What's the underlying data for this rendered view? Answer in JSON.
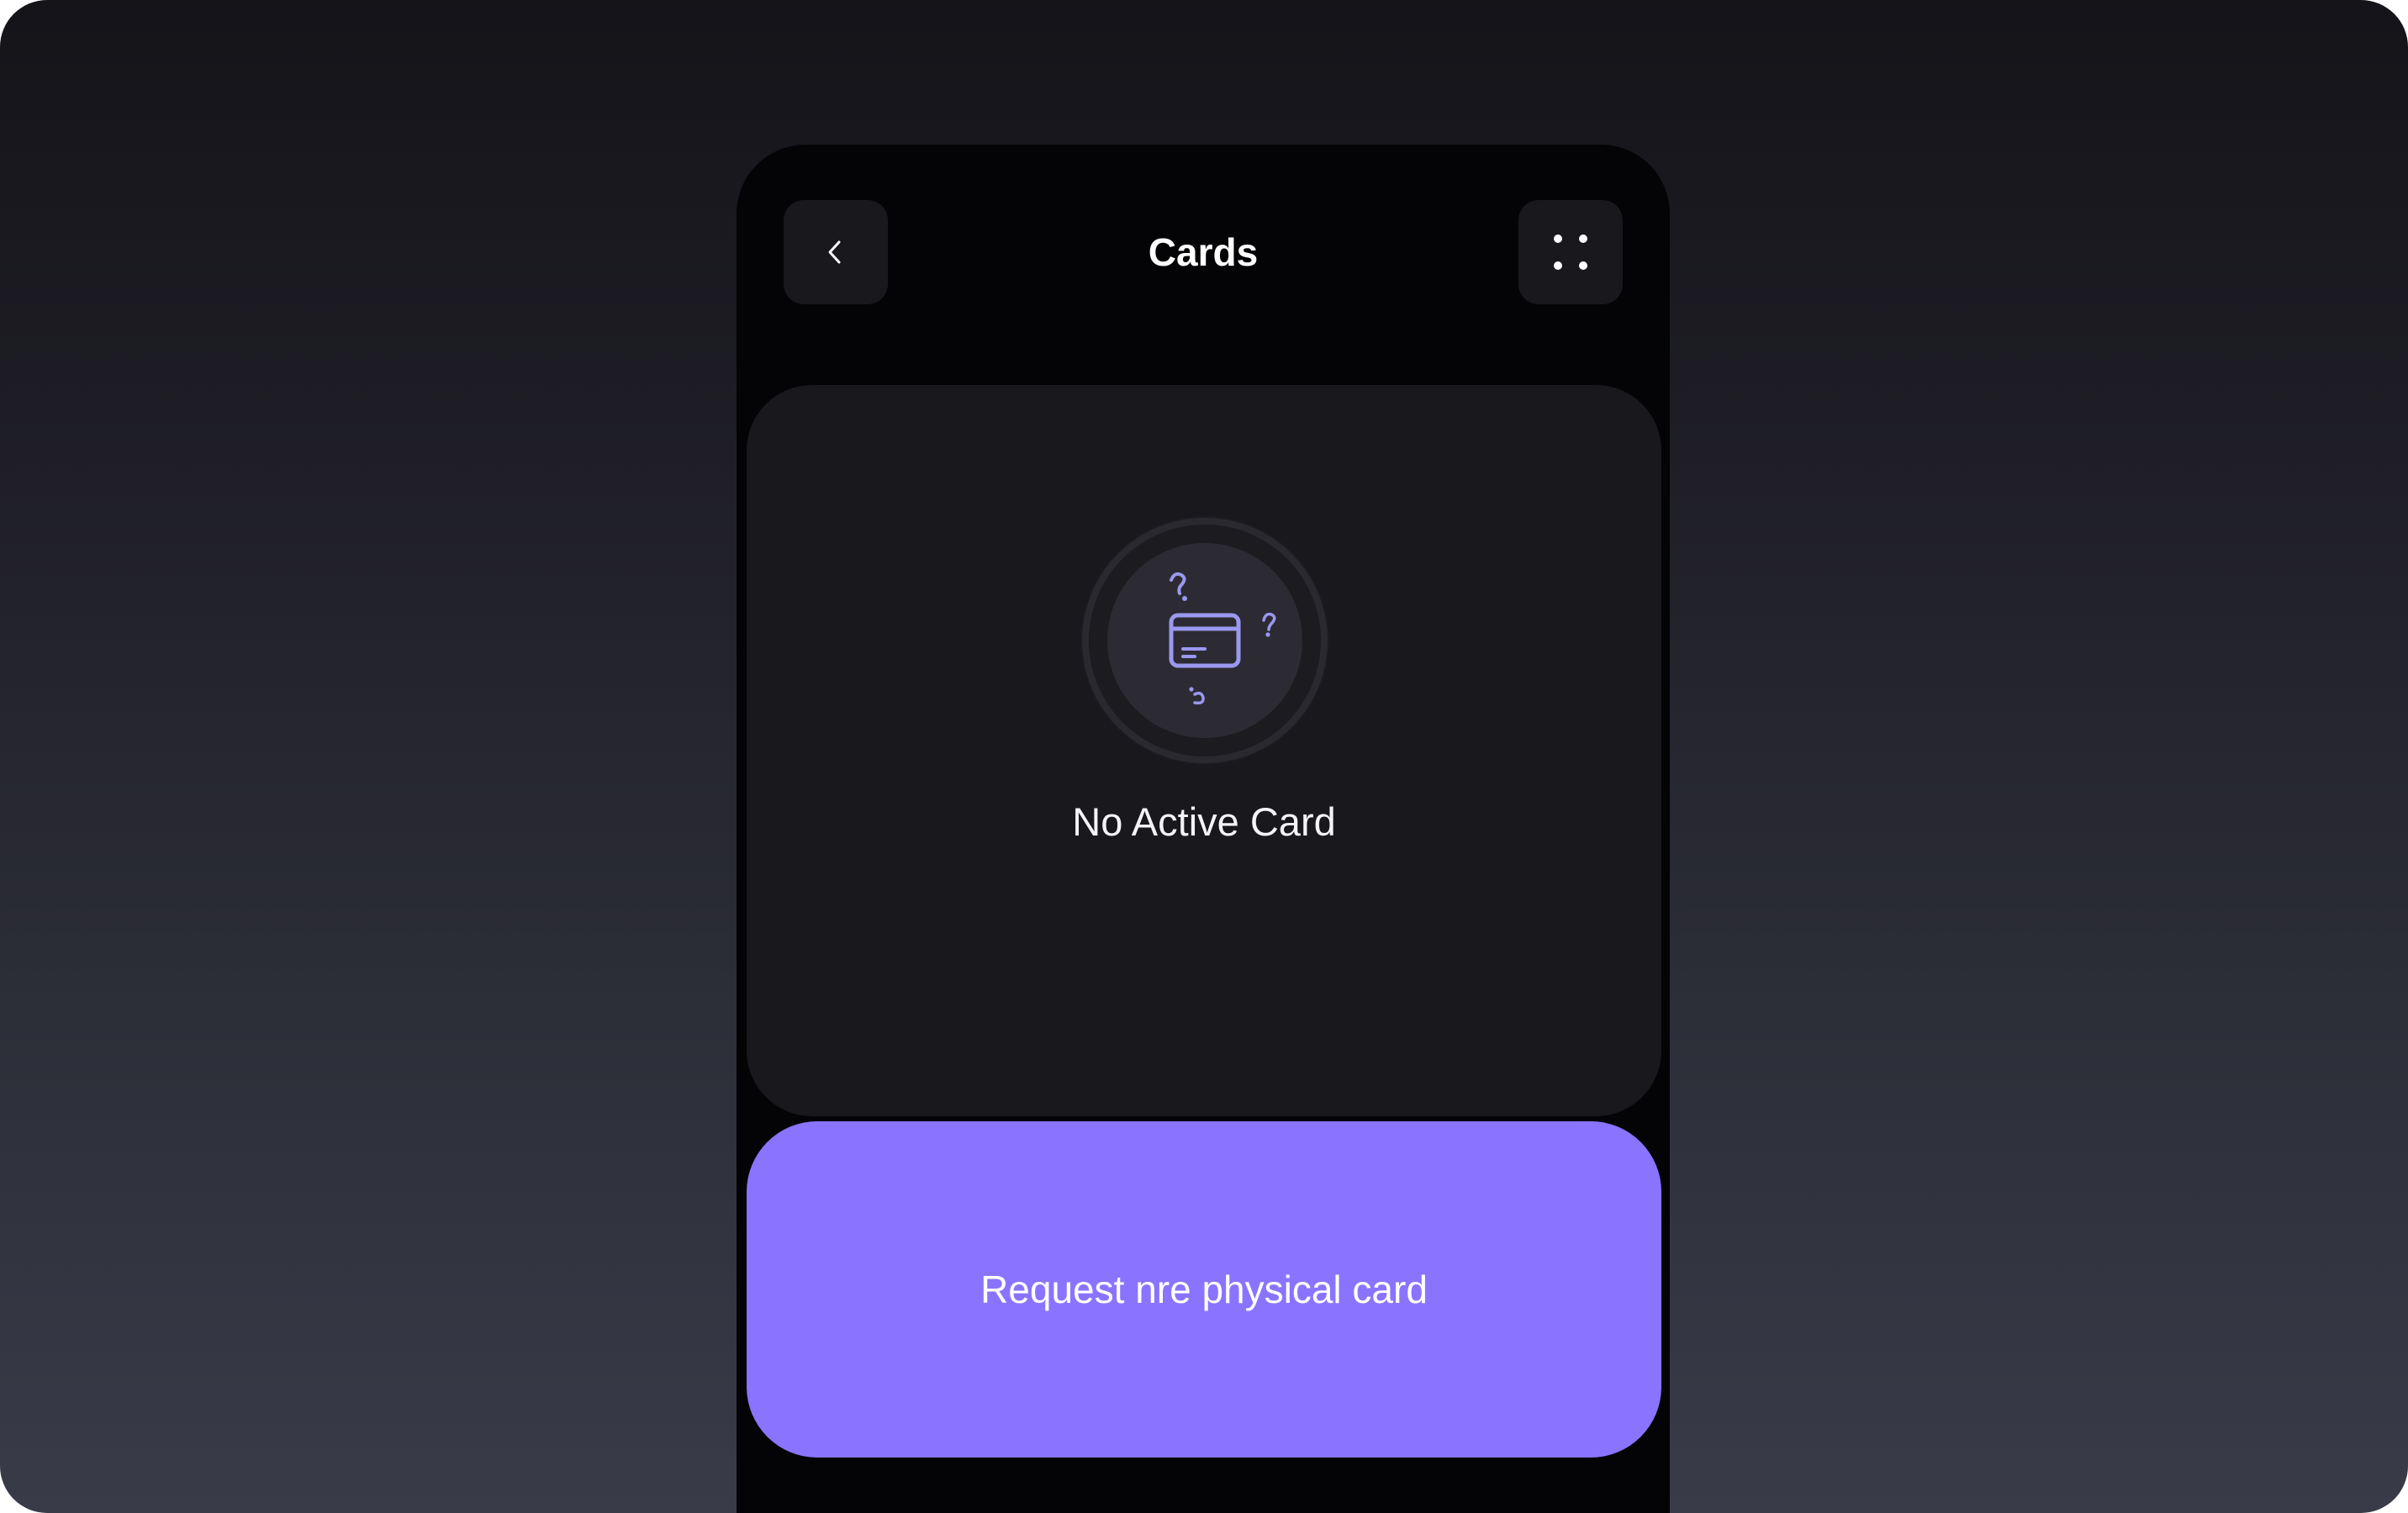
{
  "header": {
    "title": "Cards",
    "back_icon": "chevron-left-icon",
    "menu_icon": "grid-dots-icon"
  },
  "card_panel": {
    "empty_icon": "credit-card-question-icon",
    "empty_text": "No Active Card"
  },
  "primary_action": {
    "label": "Request nre physical card"
  },
  "colors": {
    "accent": "#8a74ff",
    "icon_accent": "#9a98f0",
    "phone_background": "#040406",
    "panel_background": "#19181c",
    "button_background": "#19191d"
  }
}
